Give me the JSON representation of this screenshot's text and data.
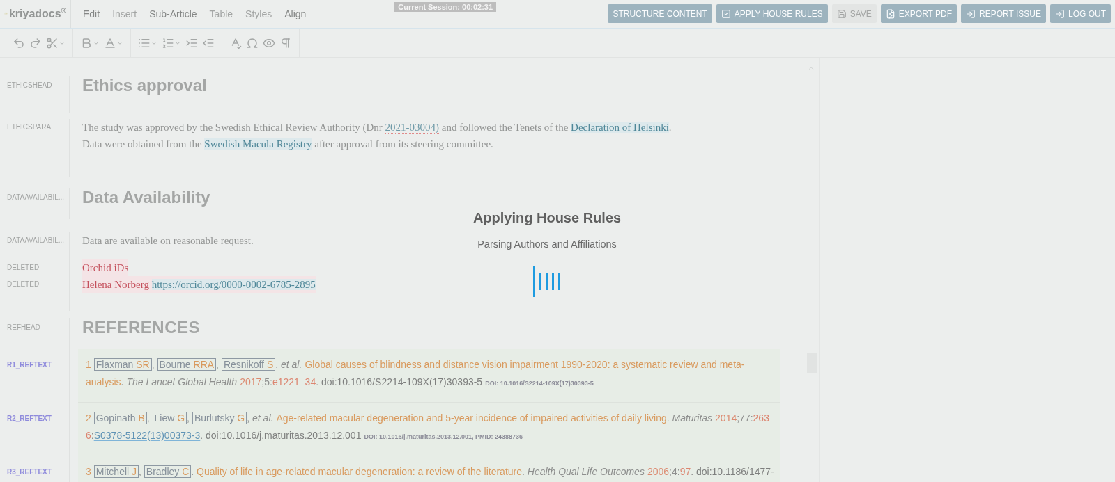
{
  "logo": "kriyadocs$^{®}$",
  "menu": [
    {
      "label": "Edit",
      "disabled": false
    },
    {
      "label": "Insert",
      "disabled": true
    },
    {
      "label": "Sub-Article",
      "disabled": false
    },
    {
      "label": "Table",
      "disabled": true
    },
    {
      "label": "Styles",
      "disabled": true
    },
    {
      "label": "Align",
      "disabled": false
    }
  ],
  "session": "Current Session: 00:02:31",
  "buttons": [
    {
      "kind": "plain",
      "label": "STRUCTURE CONTENT",
      "disabled": false
    },
    {
      "kind": "check",
      "label": "APPLY HOUSE RULES",
      "disabled": false
    },
    {
      "kind": "save",
      "label": "SAVE",
      "disabled": true
    },
    {
      "kind": "pdf",
      "label": "EXPORT PDF",
      "disabled": false
    },
    {
      "kind": "report",
      "label": "REPORT ISSUE",
      "disabled": false
    },
    {
      "kind": "logout",
      "label": "LOG OUT",
      "disabled": false
    }
  ],
  "rows": [
    {
      "kind": "heading",
      "label": "ETHICSHEAD",
      "text": "Ethics approval"
    },
    {
      "kind": "para",
      "label": "ETHICSPARA",
      "segments": [
        {
          "kind": "plain",
          "text": "The study was approved by the Swedish Ethical Review Authority (Dnr "
        },
        {
          "kind": "flag",
          "text": "2021-03004)"
        },
        {
          "kind": "plain",
          "text": " and followed the Tenets of the "
        },
        {
          "kind": "term",
          "text": "Declaration of Helsinki"
        },
        {
          "kind": "plain",
          "text": ". Data were obtained from the "
        },
        {
          "kind": "term",
          "text": "Swedish Macula Registry"
        },
        {
          "kind": "plain",
          "text": " after approval from its steering committee."
        }
      ]
    },
    {
      "kind": "heading",
      "label": "DATAAVAILABIL...",
      "text": "Data Availability"
    },
    {
      "kind": "para",
      "label": "DATAAVAILABIL...",
      "segments": [
        {
          "kind": "plain",
          "text": "Data are available on reasonable request."
        }
      ]
    },
    {
      "kind": "deleted",
      "label": "DELETED",
      "segments": [
        {
          "kind": "plain",
          "text": "Orchid iDs"
        }
      ]
    },
    {
      "kind": "deleted",
      "label": "DELETED",
      "segments": [
        {
          "kind": "plain",
          "text": "Helena Norberg "
        },
        {
          "kind": "term",
          "text": "https://orcid.org/0000-0002-6785-2895"
        }
      ]
    },
    {
      "kind": "refhead",
      "label": "REFHEAD",
      "text": "REFERENCES"
    }
  ],
  "references": [
    {
      "label": "R1_REFTEXT",
      "parts": [
        {
          "kind": "num",
          "text": "1 "
        },
        {
          "kind": "author",
          "surname": "Flaxman",
          "initials": "SR"
        },
        {
          "kind": "punct",
          "text": ", "
        },
        {
          "kind": "author",
          "surname": "Bourne",
          "initials": "RRA"
        },
        {
          "kind": "punct",
          "text": ", "
        },
        {
          "kind": "author",
          "surname": "Resnikoff",
          "initials": "S"
        },
        {
          "kind": "punct",
          "text": ", "
        },
        {
          "kind": "etal",
          "text": "et al."
        },
        {
          "kind": "title",
          "text": "Global causes of blindness and distance vision impairment 1990-2020: a systematic review and meta-analysis"
        },
        {
          "kind": "punct",
          "text": ". "
        },
        {
          "kind": "journal",
          "text": "The Lancet Global Health"
        },
        {
          "kind": "year",
          "text": "2017"
        },
        {
          "kind": "punct",
          "text": ";"
        },
        {
          "kind": "volume",
          "text": "5"
        },
        {
          "kind": "punct",
          "text": ":"
        },
        {
          "kind": "page",
          "text": "e1221"
        },
        {
          "kind": "punct",
          "text": "–"
        },
        {
          "kind": "page",
          "text": "34"
        },
        {
          "kind": "punct",
          "text": ". "
        },
        {
          "kind": "doi",
          "text": "doi:10.1016/S2214-109X(17)30393-5"
        },
        {
          "kind": "note",
          "text": "DOI: 10.1016/S2214-109X(17)30393-5"
        }
      ]
    },
    {
      "label": "R2_REFTEXT",
      "parts": [
        {
          "kind": "num",
          "text": "2 "
        },
        {
          "kind": "author",
          "surname": "Gopinath",
          "initials": "B"
        },
        {
          "kind": "punct",
          "text": ", "
        },
        {
          "kind": "author",
          "surname": "Liew",
          "initials": "G"
        },
        {
          "kind": "punct",
          "text": ", "
        },
        {
          "kind": "author",
          "surname": "Burlutsky",
          "initials": "G"
        },
        {
          "kind": "punct",
          "text": ", "
        },
        {
          "kind": "etal",
          "text": "et al."
        },
        {
          "kind": "title",
          "text": "Age-related macular degeneration and 5-year incidence of impaired activities of daily living"
        },
        {
          "kind": "punct",
          "text": ". "
        },
        {
          "kind": "journal",
          "text": "Maturitas"
        },
        {
          "kind": "year",
          "text": "2014"
        },
        {
          "kind": "punct",
          "text": ";"
        },
        {
          "kind": "volume",
          "text": "77"
        },
        {
          "kind": "punct",
          "text": ":"
        },
        {
          "kind": "page",
          "text": "263"
        },
        {
          "kind": "punct",
          "text": "–"
        },
        {
          "kind": "page",
          "text": "6"
        },
        {
          "kind": "punct",
          "text": ":"
        },
        {
          "kind": "pii",
          "text": "S0378-5122(13)00373-3"
        },
        {
          "kind": "punct",
          "text": ". "
        },
        {
          "kind": "doi",
          "text": "doi:10.1016/j.maturitas.2013.12.001"
        },
        {
          "kind": "note",
          "text": "DOI: 10.1016/j.maturitas.2013.12.001, PMID: 24388736"
        }
      ]
    },
    {
      "label": "R3_REFTEXT",
      "parts": [
        {
          "kind": "num",
          "text": "3 "
        },
        {
          "kind": "author",
          "surname": "Mitchell",
          "initials": "J"
        },
        {
          "kind": "punct",
          "text": ", "
        },
        {
          "kind": "author",
          "surname": "Bradley",
          "initials": "C"
        },
        {
          "kind": "punct",
          "text": ". "
        },
        {
          "kind": "title",
          "text": "Quality of life in age-related macular degeneration: a review of the literature"
        },
        {
          "kind": "punct",
          "text": ". "
        },
        {
          "kind": "journal",
          "text": "Health Qual Life Outcomes"
        },
        {
          "kind": "year",
          "text": "2006"
        },
        {
          "kind": "punct",
          "text": ";"
        },
        {
          "kind": "volume",
          "text": "4"
        },
        {
          "kind": "punct",
          "text": ":"
        },
        {
          "kind": "page",
          "text": "97"
        },
        {
          "kind": "punct",
          "text": ". "
        },
        {
          "kind": "doi",
          "text": "doi:10.1186/1477-"
        }
      ]
    }
  ],
  "loading": {
    "title": "Applying House Rules",
    "message": "Parsing Authors and Affiliations"
  }
}
